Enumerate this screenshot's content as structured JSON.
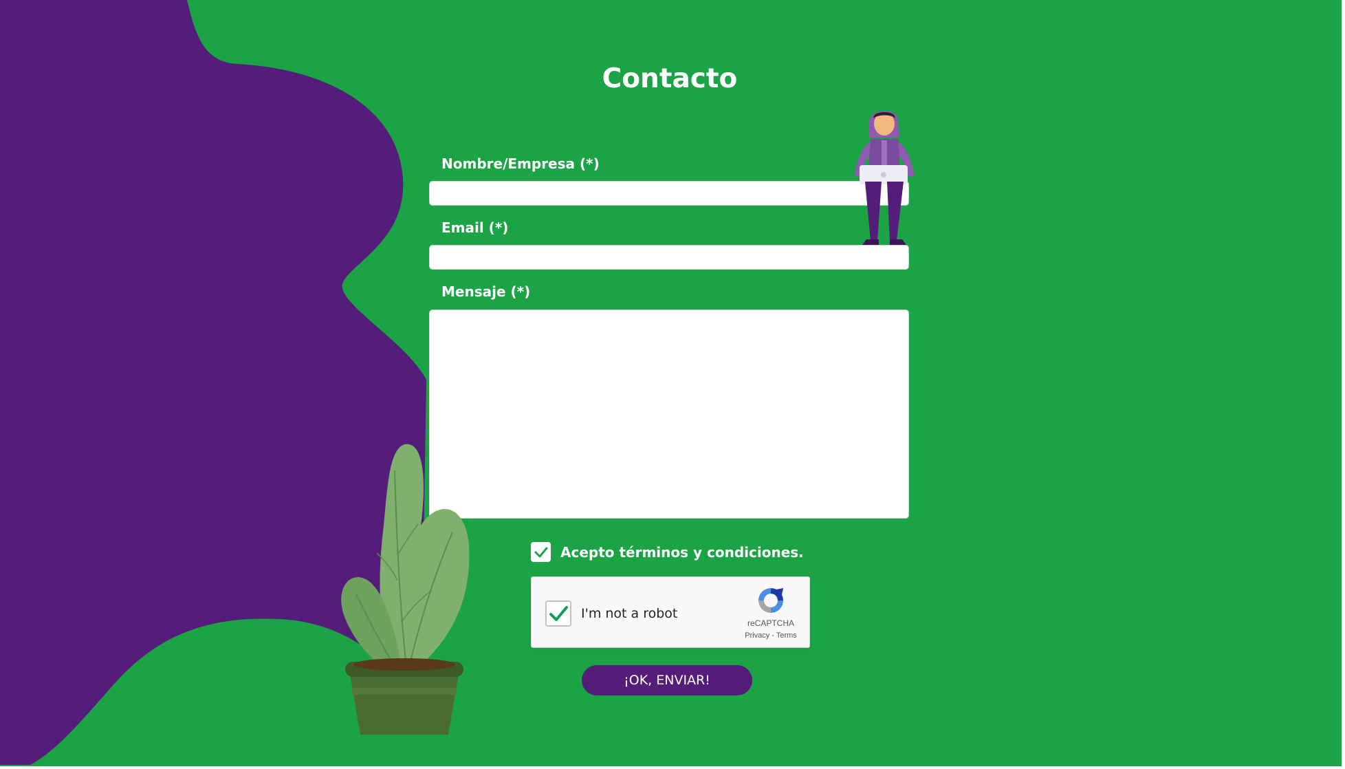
{
  "page": {
    "title": "Contacto"
  },
  "form": {
    "name_label": "Nombre/Empresa (*)",
    "name_value": "",
    "email_label": "Email (*)",
    "email_value": "",
    "message_label": "Mensaje (*)",
    "message_value": "",
    "terms_label": "Acepto términos y condiciones.",
    "terms_checked": true,
    "submit_label": "¡OK, ENVIAR!"
  },
  "captcha": {
    "label": "I'm not a robot",
    "brand": "reCAPTCHA",
    "links": "Privacy - Terms",
    "checked": true
  },
  "colors": {
    "background": "#1ba345",
    "blob": "#531d79",
    "button": "#531d79"
  }
}
